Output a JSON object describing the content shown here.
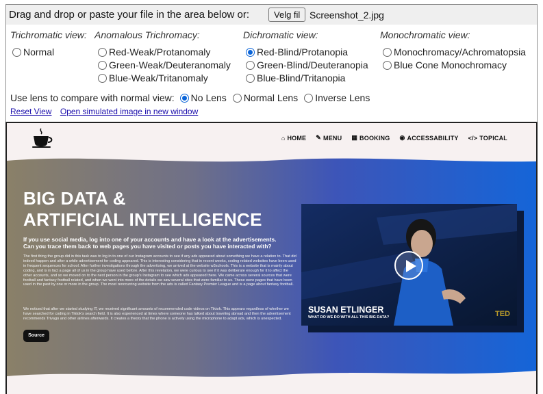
{
  "dropzone": {
    "prompt": "Drag and drop or paste your file in the area below or:",
    "file_button": "Velg fil",
    "file_name": "Screenshot_2.jpg"
  },
  "views": {
    "trichromatic": {
      "heading": "Trichromatic view:",
      "options": [
        "Normal"
      ]
    },
    "anomalous": {
      "heading": "Anomalous Trichromacy:",
      "options": [
        "Red-Weak/Protanomaly",
        "Green-Weak/Deuteranomaly",
        "Blue-Weak/Tritanomaly"
      ]
    },
    "dichromatic": {
      "heading": "Dichromatic view:",
      "options": [
        "Red-Blind/Protanopia",
        "Green-Blind/Deuteranopia",
        "Blue-Blind/Tritanopia"
      ]
    },
    "monochromatic": {
      "heading": "Monochromatic view:",
      "options": [
        "Monochromacy/Achromatopsia",
        "Blue Cone Monochromacy"
      ]
    },
    "selected": "Red-Blind/Protanopia"
  },
  "lens": {
    "label": "Use lens to compare with normal view:",
    "options": [
      "No Lens",
      "Normal Lens",
      "Inverse Lens"
    ],
    "selected": "No Lens"
  },
  "links": {
    "reset": "Reset View",
    "open": "Open simulated image in new window"
  },
  "site": {
    "nav": [
      {
        "icon": "home-icon",
        "label": "HOME"
      },
      {
        "icon": "menu-icon",
        "label": "MENU"
      },
      {
        "icon": "booking-icon",
        "label": "BOOKING"
      },
      {
        "icon": "accessability-icon",
        "label": "ACCESSABILITY"
      },
      {
        "icon": "code-icon",
        "label": "TOPICAL"
      }
    ],
    "title_line1": "BIG DATA &",
    "title_line2": "ARTIFICIAL INTELLIGENCE",
    "lead": "If you use social media, log into one of your accounts and have a look at the advertisements. Can you trace them back to web pages you have visited or posts you have interacted with?",
    "body1": "The first thing the group did in this task was to log in to one of our Instagram accounts to see if any ads appeared about something we have a relation to. That did indeed happen and after a while advertisement for coding appeared. This is interesting considering that in recent weeks, coding related websites have been used in frequent sequences for school. After further investigations through the advertising, we arrived at the website w3schools. This is a website that is mainly about coding, and is in fact a page all of us in the group have used before. After this revelation, we were curious to see if it was deliberate enough for it to affect the other accounts, and so we moved on to the next person in the group's Instagram to see which ads appeared there. We came across several sources that were football and fantasy football related, and when we went into more of the details we saw several sites that were familiar to us. These were pages that have been used in the past by one or more in the group. The most reoccurring website from the ads is called Fantasy Premier League and is a page about fantasy football.",
    "body2": "We noticed that after we started studying IT, we received significant amounts of recommended code videos on Tiktok. This appears regardless of whether we have searched for coding in Tiktok's search field. It is also experienced at times where someone has talked about traveling abroad and then the advertisement recommends Trivago and other airlines afterwards. It creates a theory that the phone is actively using the microphone to adapt ads, which is unexpected.",
    "source_button": "Source",
    "video": {
      "speaker": "SUSAN ETLINGER",
      "subtitle": "WHAT DO WE DO WITH ALL THIS BIG DATA?",
      "brand": "TED"
    }
  },
  "colors": {
    "radio_selected": "#0a64d8",
    "hero_left": "#8a8068",
    "hero_right": "#1565d8",
    "page_bg": "#f7f1f1"
  }
}
